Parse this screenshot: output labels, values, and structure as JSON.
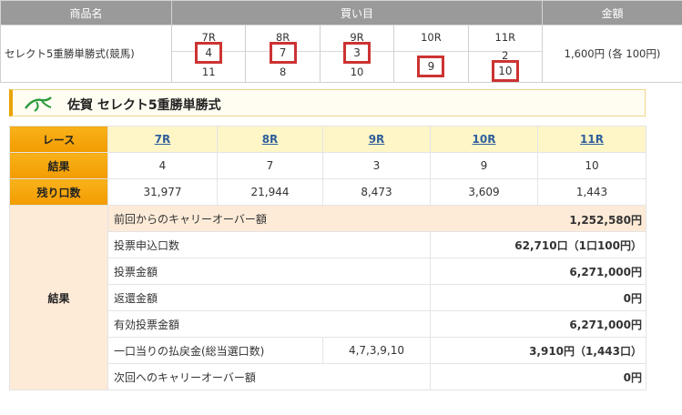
{
  "top": {
    "headers": {
      "product": "商品名",
      "bets": "買い目",
      "amount": "金額"
    },
    "product_name": "セレクト5重勝単勝式(競馬)",
    "amount": "1,600円 (各 100円)",
    "bet_columns": [
      {
        "race": "7R",
        "top": "4",
        "bottom": "11",
        "top_highlighted": true,
        "bottom_highlighted": false
      },
      {
        "race": "8R",
        "top": "7",
        "bottom": "8",
        "top_highlighted": true,
        "bottom_highlighted": false
      },
      {
        "race": "9R",
        "top": "3",
        "bottom": "10",
        "top_highlighted": true,
        "bottom_highlighted": false
      },
      {
        "race": "10R",
        "top": "",
        "bottom": "9",
        "top_highlighted": false,
        "bottom_highlighted": true
      },
      {
        "race": "11R",
        "top": "2",
        "bottom": "10",
        "top_highlighted": false,
        "bottom_highlighted": true
      }
    ]
  },
  "section": {
    "title": "佐賀 セレクト5重勝単勝式"
  },
  "results": {
    "race_label": "レース",
    "result_label": "結果",
    "remaining_label": "残り口数",
    "races": [
      "7R",
      "8R",
      "9R",
      "10R",
      "11R"
    ],
    "results": [
      "4",
      "7",
      "3",
      "9",
      "10"
    ],
    "remaining": [
      "31,977",
      "21,944",
      "8,473",
      "3,609",
      "1,443"
    ],
    "summary_label": "結果",
    "rows": [
      {
        "label": "前回からのキャリーオーバー額",
        "mid": "",
        "value": "1,252,580円"
      },
      {
        "label": "投票申込口数",
        "mid": "",
        "value": "62,710口（1口100円）"
      },
      {
        "label": "投票金額",
        "mid": "",
        "value": "6,271,000円"
      },
      {
        "label": "返還金額",
        "mid": "",
        "value": "0円"
      },
      {
        "label": "有効投票金額",
        "mid": "",
        "value": "6,271,000円"
      },
      {
        "label": "一口当りの払戻金(総当選口数)",
        "mid": "4,7,3,9,10",
        "value": "3,910円（1,443口）"
      },
      {
        "label": "次回へのキャリーオーバー額",
        "mid": "",
        "value": "0円"
      }
    ]
  },
  "colors": {
    "header_gray": "#9a9a9a",
    "orange": "#f6a800",
    "highlight_red": "#cc3333",
    "link_blue": "#2e5f9a"
  }
}
